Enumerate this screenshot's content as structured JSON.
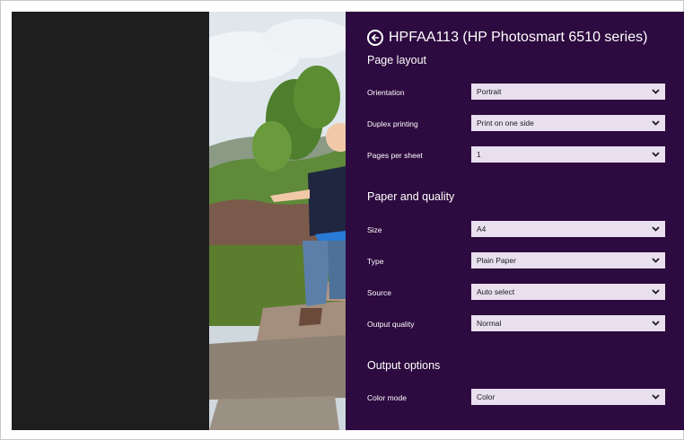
{
  "panel": {
    "title": "HPFAA113 (HP Photosmart 6510 series)",
    "back_icon": "back-arrow-circle-icon",
    "accent_bg": "#2d0a3f",
    "select_bg": "#e8e0ee"
  },
  "sections": {
    "page_layout": {
      "heading": "Page layout",
      "orientation": {
        "label": "Orientation",
        "value": "Portrait"
      },
      "duplex": {
        "label": "Duplex printing",
        "value": "Print on one side"
      },
      "pages_per_sheet": {
        "label": "Pages per sheet",
        "value": "1"
      }
    },
    "paper_quality": {
      "heading": "Paper and quality",
      "size": {
        "label": "Size",
        "value": "A4"
      },
      "type": {
        "label": "Type",
        "value": "Plain Paper"
      },
      "source": {
        "label": "Source",
        "value": "Auto select"
      },
      "output_quality": {
        "label": "Output quality",
        "value": "Normal"
      }
    },
    "output_options": {
      "heading": "Output options",
      "color_mode": {
        "label": "Color mode",
        "value": "Color"
      }
    }
  }
}
